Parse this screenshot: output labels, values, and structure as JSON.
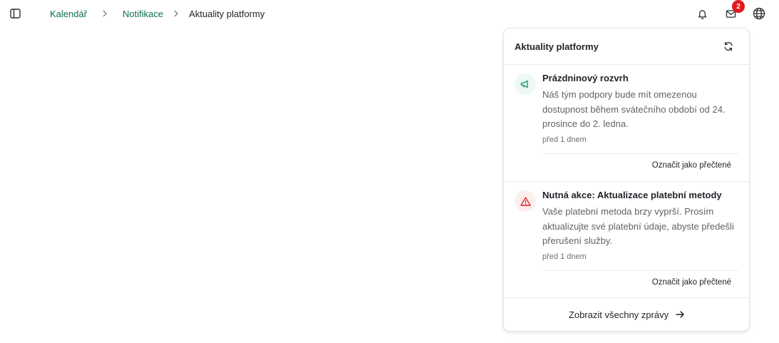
{
  "breadcrumb": {
    "items": [
      {
        "label": "Kalendář"
      },
      {
        "label": "Notifikace"
      },
      {
        "label": "Aktuality platformy"
      }
    ]
  },
  "topbar": {
    "mail_badge": "2"
  },
  "panel": {
    "title": "Aktuality platformy",
    "notifications": [
      {
        "icon": "megaphone-icon",
        "title": "Prázdninový rozvrh",
        "body": "Náš tým podpory bude mít omezenou dostupnost během svátečního období od 24. prosince do 2. ledna.",
        "time": "před 1 dnem",
        "action": "Označit jako přečtené",
        "color": "#1b9e77"
      },
      {
        "icon": "warning-icon",
        "title": "Nutná akce: Aktualizace platební metody",
        "body": "Vaše platební metoda brzy vyprší. Prosím aktualizujte své platební údaje, abyste předešli přerušení služby.",
        "time": "před 1 dnem",
        "action": "Označit jako přečtené",
        "color": "#e0191f"
      }
    ],
    "footer_label": "Zobrazit všechny zprávy"
  },
  "colors": {
    "accent": "#0e6e53",
    "badge": "#e0191f"
  }
}
